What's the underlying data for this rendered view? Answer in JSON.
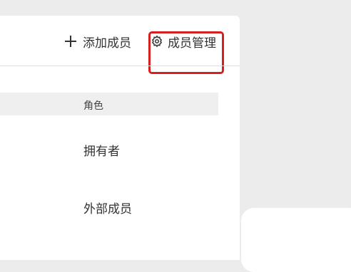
{
  "toolbar": {
    "add_member_label": "添加成员",
    "manage_members_label": "成员管理"
  },
  "table": {
    "role_column_header": "角色",
    "rows": [
      {
        "role": "拥有者"
      },
      {
        "role": "外部成员"
      }
    ]
  },
  "icons": {
    "add": "plus-icon",
    "manage": "gear-icon"
  },
  "colors": {
    "highlight": "#d61f1f",
    "header_bg": "#efefef",
    "panel_bg": "#ffffff",
    "page_bg": "#ececec"
  }
}
